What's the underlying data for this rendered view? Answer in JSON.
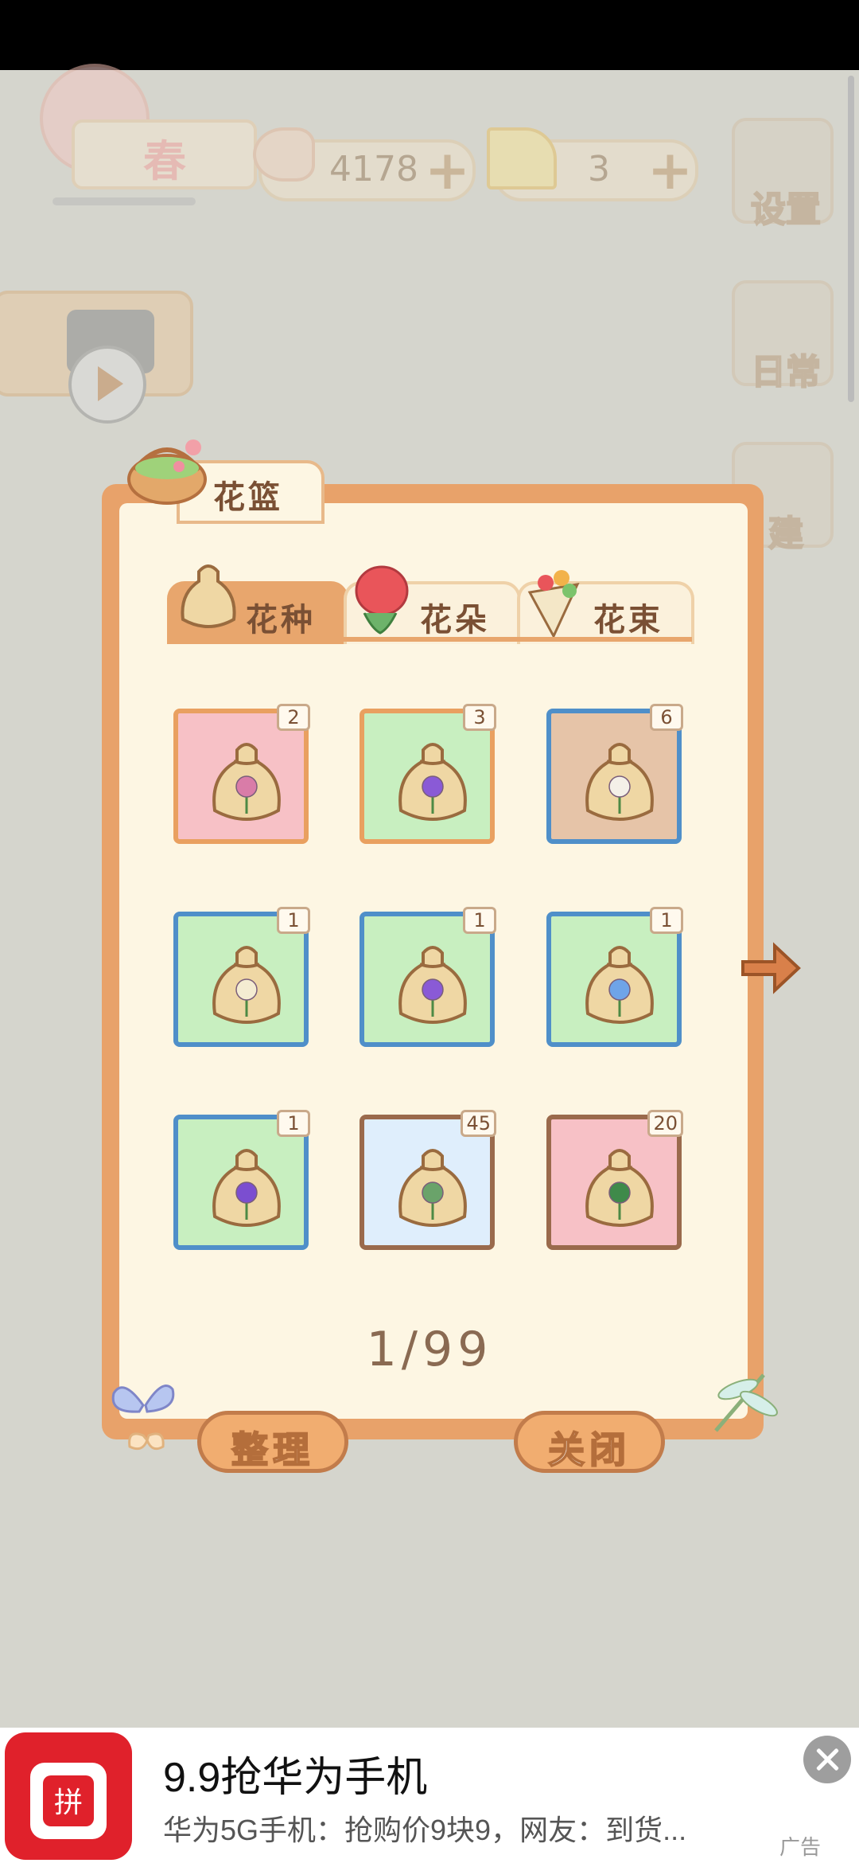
{
  "hud": {
    "season_label": "春",
    "fish_count": "4178",
    "cheese_count": "3",
    "plus_symbol": "+",
    "settings_label": "设置",
    "daily_label": "日常",
    "build_label": "建"
  },
  "basket": {
    "title": "花篮",
    "tabs": [
      {
        "label": "花种",
        "active": true
      },
      {
        "label": "花朵",
        "active": false
      },
      {
        "label": "花束",
        "active": false
      }
    ],
    "items": [
      {
        "count": "2",
        "bg": "#f7c1c6",
        "border": "#e9a060",
        "flower": "#d97ca8"
      },
      {
        "count": "3",
        "bg": "#c8efc0",
        "border": "#e9a060",
        "flower": "#8a5ad6"
      },
      {
        "count": "6",
        "bg": "#e6c4a8",
        "border": "#4f8fc9",
        "flower": "#f4f0e8"
      },
      {
        "count": "1",
        "bg": "#c8efc0",
        "border": "#4f8fc9",
        "flower": "#f4ecd2"
      },
      {
        "count": "1",
        "bg": "#c8efc0",
        "border": "#4f8fc9",
        "flower": "#8a5ad6"
      },
      {
        "count": "1",
        "bg": "#c8efc0",
        "border": "#4f8fc9",
        "flower": "#6fa4e8"
      },
      {
        "count": "1",
        "bg": "#c8efc0",
        "border": "#4f8fc9",
        "flower": "#7b4ed0"
      },
      {
        "count": "45",
        "bg": "#dfeefc",
        "border": "#9a6a4c",
        "flower": "#6aa36a"
      },
      {
        "count": "20",
        "bg": "#f7c1c6",
        "border": "#9a6a4c",
        "flower": "#3f8a4a"
      }
    ],
    "page": "1/99",
    "sort_button": "整理",
    "close_button": "关闭"
  },
  "ad": {
    "logo_text": "拼",
    "title": "9.9抢华为手机",
    "subtitle": "华为5G手机：抢购价9块9，网友：到货...",
    "tag": "广告"
  }
}
